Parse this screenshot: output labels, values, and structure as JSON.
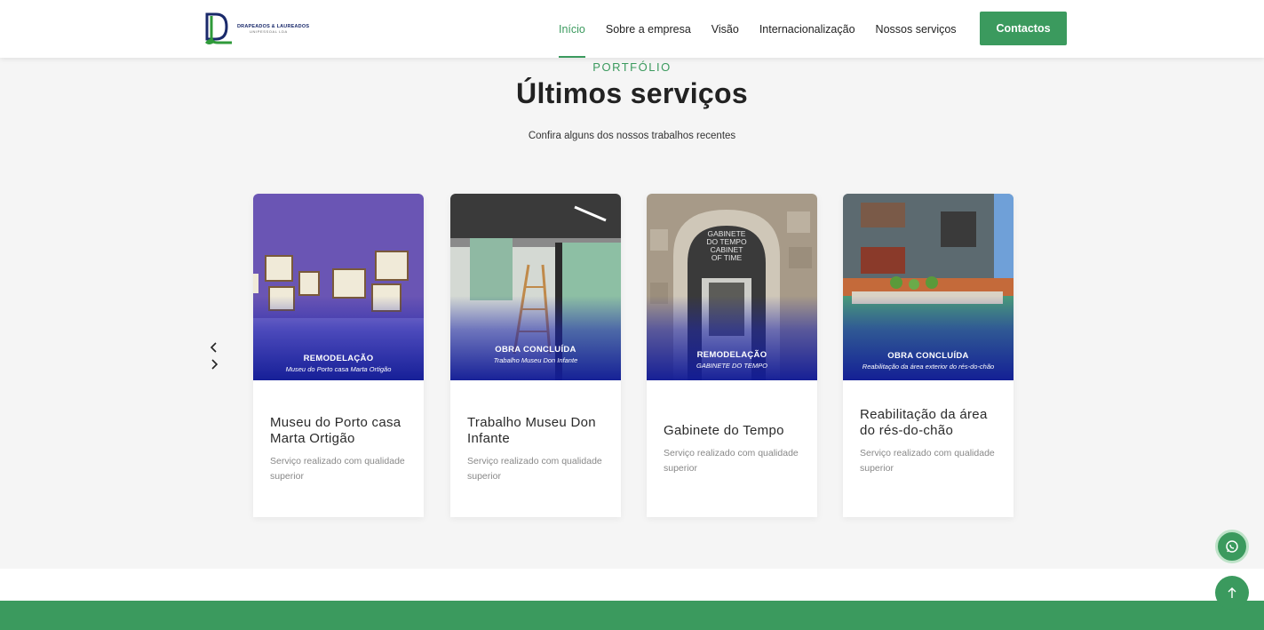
{
  "brand": {
    "logo_line1": "DRAPEADOS & LAUREADOS",
    "logo_line2": "UNIPESSOAL LDA"
  },
  "nav": {
    "items": [
      {
        "label": "Início",
        "active": true
      },
      {
        "label": "Sobre a empresa",
        "active": false
      },
      {
        "label": "Visão",
        "active": false
      },
      {
        "label": "Internacionalização",
        "active": false
      },
      {
        "label": "Nossos serviços",
        "active": false
      }
    ],
    "cta_label": "Contactos"
  },
  "section": {
    "eyebrow": "PORTFÓLIO",
    "title": "Últimos serviços",
    "subtitle": "Confira alguns dos nossos trabalhos recentes"
  },
  "cards": [
    {
      "tag": "REMODELAÇÃO",
      "overlay_sub": "Museu do Porto casa Marta Ortigão",
      "title": "Museu do Porto casa Marta Ortigão",
      "desc": "Serviço realizado com qualidade superior"
    },
    {
      "tag": "OBRA CONCLUÍDA",
      "overlay_sub": "Trabalho Museu Don Infante",
      "title": "Trabalho Museu Don Infante",
      "desc": "Serviço realizado com qualidade superior"
    },
    {
      "tag": "REMODELAÇÃO",
      "overlay_sub": "GABINETE DO TEMPO",
      "title": "Gabinete do Tempo",
      "desc": "Serviço realizado com qualidade superior"
    },
    {
      "tag": "OBRA CONCLUÍDA",
      "overlay_sub": "Reabilitação da área exterior do rés-do-chão",
      "title": "Reabilitação da área do rés-do-chão",
      "desc": "Serviço realizado com qualidade superior"
    }
  ],
  "card3_sign": [
    "GABINETE",
    "DO TEMPO",
    "CABINET",
    "OF TIME"
  ],
  "icons": {
    "prev": "chevron-left-icon",
    "next": "chevron-right-icon",
    "whatsapp": "whatsapp-icon",
    "to_top": "arrow-up-icon"
  },
  "colors": {
    "accent": "#3b9a5e",
    "overlay_blue": "#1a23aa"
  }
}
